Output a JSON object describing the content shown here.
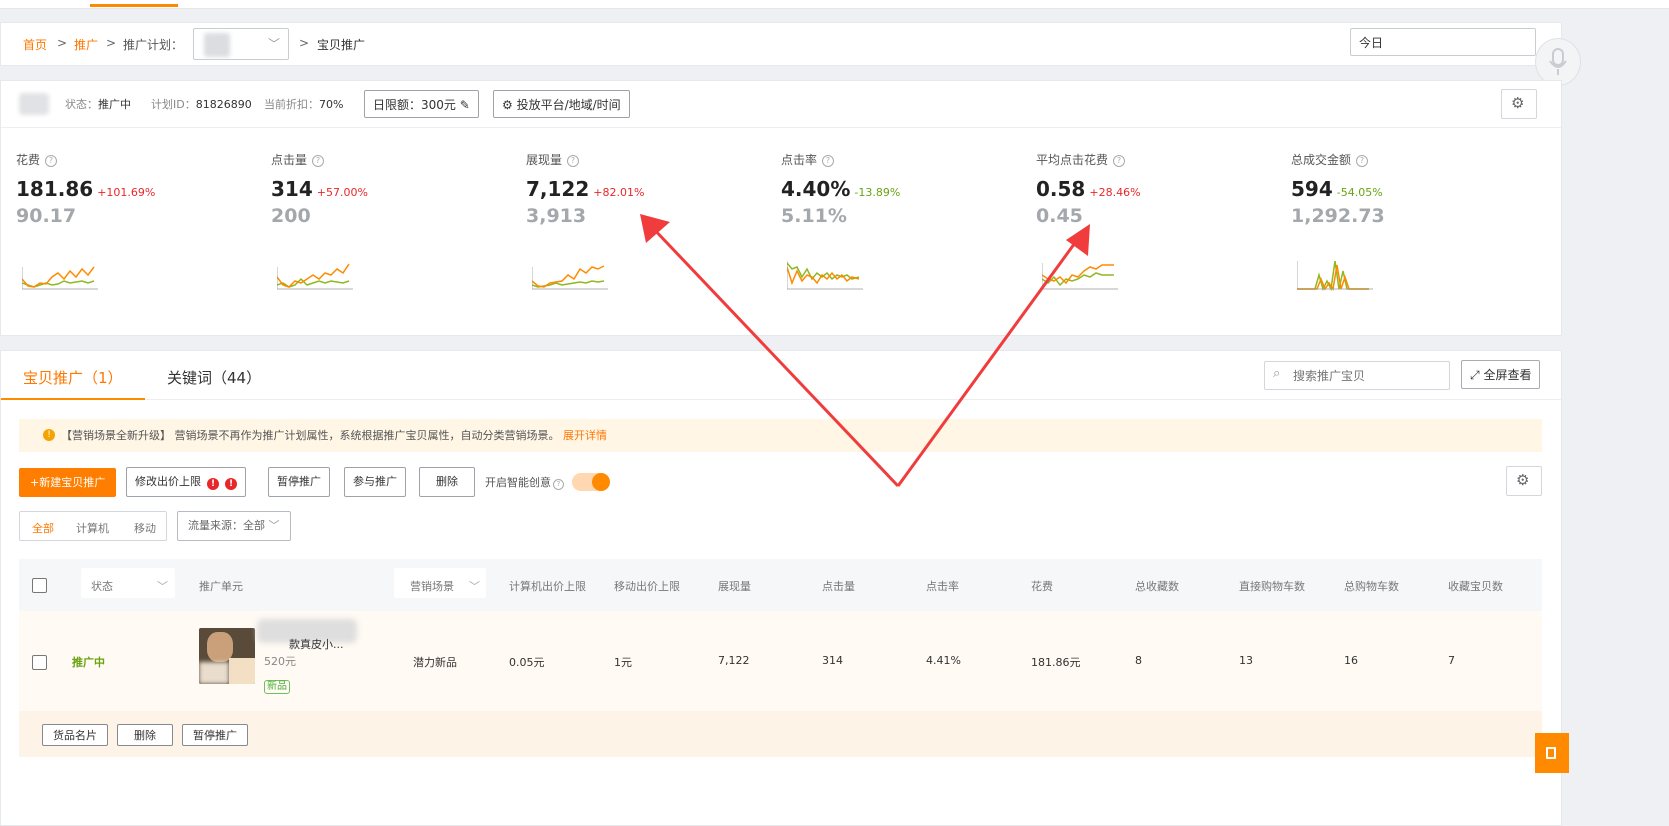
{
  "breadcrumb": {
    "home": "首页",
    "sep": ">",
    "promo": "推广",
    "plan_label": "推广计划：",
    "item_promo": "宝贝推广"
  },
  "date_range": {
    "value": "今日"
  },
  "plan": {
    "status_label": "状态：",
    "status_value": "推广中",
    "id_label": "计划ID：",
    "id_value": "81826890",
    "discount_label": "当前折扣：",
    "discount_value": "70%",
    "budget_btn": "日限额：300元",
    "placement_btn": "投放平台/地域/时间"
  },
  "metrics": [
    {
      "label": "花费",
      "value": "181.86",
      "change": "+101.69%",
      "dir": "up",
      "prev": "90.17"
    },
    {
      "label": "点击量",
      "value": "314",
      "change": "+57.00%",
      "dir": "up",
      "prev": "200"
    },
    {
      "label": "展现量",
      "value": "7,122",
      "change": "+82.01%",
      "dir": "up",
      "prev": "3,913"
    },
    {
      "label": "点击率",
      "value": "4.40%",
      "change": "-13.89%",
      "dir": "down",
      "prev": "5.11%"
    },
    {
      "label": "平均点击花费",
      "value": "0.58",
      "change": "+28.46%",
      "dir": "up",
      "prev": "0.45"
    },
    {
      "label": "总成交金额",
      "value": "594",
      "change": "-54.05%",
      "dir": "down",
      "prev": "1,292.73"
    }
  ],
  "colors": {
    "accent": "#ff8a00",
    "up": "#e8272b",
    "down": "#6aa212",
    "sparkline_current": "#ff8a00",
    "sparkline_prev": "#8fb820",
    "annotation_arrow": "#f03c3c"
  },
  "tabs": [
    {
      "label": "宝贝推广（1）",
      "active": true
    },
    {
      "label": "关键词（44）",
      "active": false
    }
  ],
  "search": {
    "placeholder": "搜索推广宝贝"
  },
  "fullscreen_btn": "全屏查看",
  "notice": {
    "text": "【营销场景全新升级】 营销场景不再作为推广计划属性，系统根据推广宝贝属性，自动分类营销场景。",
    "link": "展开详情"
  },
  "actions": {
    "new": "+新建宝贝推广",
    "edit_price": "修改出价上限",
    "pause": "暂停推广",
    "join": "参与推广",
    "delete": "删除",
    "smart_creative": "开启智能创意"
  },
  "device_filter": [
    "全部",
    "计算机",
    "移动"
  ],
  "traffic_filter": "流量来源：全部",
  "table": {
    "headers": {
      "status": "状态",
      "unit": "推广单元",
      "scene": "营销场景",
      "pc_bid": "计算机出价上限",
      "mobile_bid": "移动出价上限",
      "impressions": "展现量",
      "clicks": "点击量",
      "ctr": "点击率",
      "cost": "花费",
      "fav_total": "总收藏数",
      "cart_direct": "直接购物车数",
      "cart_total": "总购物车数",
      "fav_item": "收藏宝贝数"
    },
    "rows": [
      {
        "status": "推广中",
        "title": "款真皮小...",
        "price": "520元",
        "tag": "新品",
        "scene": "潜力新品",
        "pc_bid": "0.05元",
        "mobile_bid": "1元",
        "impressions": "7,122",
        "clicks": "314",
        "ctr": "4.41%",
        "cost": "181.86元",
        "fav_total": "8",
        "cart_direct": "13",
        "cart_total": "16",
        "fav_item": "7"
      }
    ]
  },
  "row_actions": [
    "货品名片",
    "删除",
    "暂停推广"
  ]
}
